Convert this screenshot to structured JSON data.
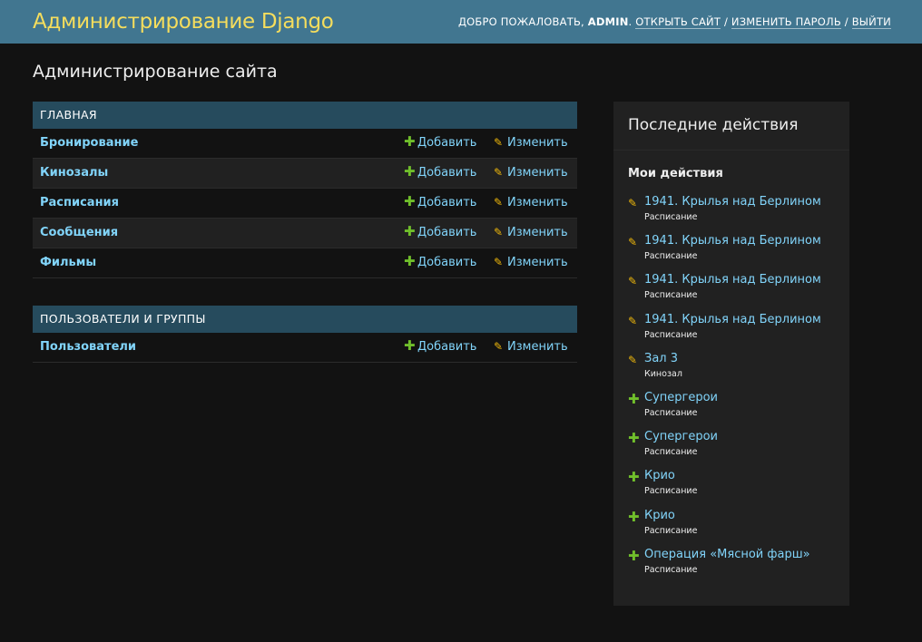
{
  "header": {
    "branding": "Администрирование Django",
    "welcome": "ДОБРО ПОЖАЛОВАТЬ, ",
    "username": "ADMIN",
    "period": ".",
    "view_site": "ОТКРЫТЬ САЙТ",
    "sep1": " / ",
    "change_password": "ИЗМЕНИТЬ ПАРОЛЬ",
    "sep2": " / ",
    "logout": "ВЫЙТИ"
  },
  "page_title": "Администрирование сайта",
  "modules": [
    {
      "caption": "ГЛАВНАЯ",
      "models": [
        {
          "name": "Бронирование",
          "add": "Добавить",
          "change": "Изменить"
        },
        {
          "name": "Кинозалы",
          "add": "Добавить",
          "change": "Изменить"
        },
        {
          "name": "Расписания",
          "add": "Добавить",
          "change": "Изменить"
        },
        {
          "name": "Сообщения",
          "add": "Добавить",
          "change": "Изменить"
        },
        {
          "name": "Фильмы",
          "add": "Добавить",
          "change": "Изменить"
        }
      ]
    },
    {
      "caption": "ПОЛЬЗОВАТЕЛИ И ГРУППЫ",
      "models": [
        {
          "name": "Пользователи",
          "add": "Добавить",
          "change": "Изменить"
        }
      ]
    }
  ],
  "sidebar": {
    "title": "Последние действия",
    "subtitle": "Мои действия",
    "actions": [
      {
        "icon": "pencil-icon",
        "kind": "change",
        "label": "1941. Крылья над Берлином",
        "type": "Расписание"
      },
      {
        "icon": "pencil-icon",
        "kind": "change",
        "label": "1941. Крылья над Берлином",
        "type": "Расписание"
      },
      {
        "icon": "pencil-icon",
        "kind": "change",
        "label": "1941. Крылья над Берлином",
        "type": "Расписание"
      },
      {
        "icon": "pencil-icon",
        "kind": "change",
        "label": "1941. Крылья над Берлином",
        "type": "Расписание"
      },
      {
        "icon": "pencil-icon",
        "kind": "change",
        "label": "Зал 3",
        "type": "Кинозал"
      },
      {
        "icon": "plus-icon",
        "kind": "add",
        "label": "Супергерои",
        "type": "Расписание"
      },
      {
        "icon": "plus-icon",
        "kind": "add",
        "label": "Супергерои",
        "type": "Расписание"
      },
      {
        "icon": "plus-icon",
        "kind": "add",
        "label": "Крио",
        "type": "Расписание"
      },
      {
        "icon": "plus-icon",
        "kind": "add",
        "label": "Крио",
        "type": "Расписание"
      },
      {
        "icon": "plus-icon",
        "kind": "add",
        "label": "Операция «Мясной фарш»",
        "type": "Расписание"
      }
    ]
  },
  "colors": {
    "header_bg": "#417690",
    "branding": "#f5dd5d",
    "caption_bg": "#264b5d",
    "link": "#81d4fa",
    "add_icon": "#70bf2b",
    "change_icon": "#efb80b",
    "page_bg": "#121212"
  }
}
